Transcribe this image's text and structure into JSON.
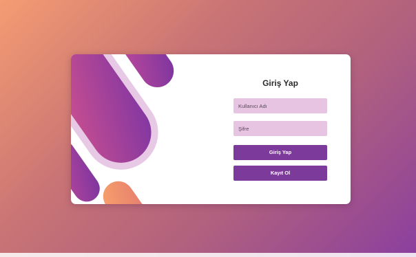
{
  "login_form": {
    "title": "Giriş Yap",
    "username_placeholder": "Kullanıcı Adı",
    "password_placeholder": "Şifre",
    "login_button": "Giriş Yap",
    "register_button": "Kayıt Ol"
  },
  "colors": {
    "background_start": "#f49c72",
    "background_end": "#8b3f9e",
    "input_background": "#e6c4e2",
    "button_background": "#7c3a9b",
    "card_background": "#ffffff"
  }
}
